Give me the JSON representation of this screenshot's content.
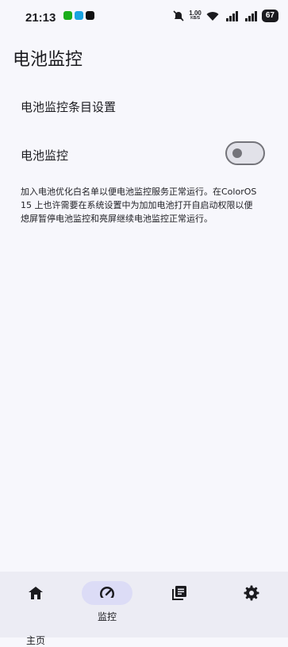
{
  "status_bar": {
    "time": "21:13",
    "net_speed_value": "1.00",
    "net_speed_unit": "KB/S",
    "battery": "67"
  },
  "page": {
    "title": "电池监控",
    "entry_settings": "电池监控条目设置",
    "switch_label": "电池监控",
    "switch_on": false,
    "description": "加入电池优化白名单以便电池监控服务正常运行。在ColorOS 15 上也许需要在系统设置中为加加电池打开自启动权限以便熄屏暂停电池监控和亮屏继续电池监控正常运行。"
  },
  "bottom_nav": {
    "items": [
      {
        "label": "主页",
        "icon": "home-icon",
        "active": false
      },
      {
        "label": "监控",
        "icon": "gauge-icon",
        "active": true
      },
      {
        "label": "",
        "icon": "library-icon",
        "active": false
      },
      {
        "label": "",
        "icon": "gear-icon",
        "active": false
      }
    ]
  },
  "colors": {
    "background": "#f7f7fc",
    "nav_background": "#ececf4",
    "active_pill": "#dcdcf6",
    "toggle_outline": "#74747a"
  }
}
